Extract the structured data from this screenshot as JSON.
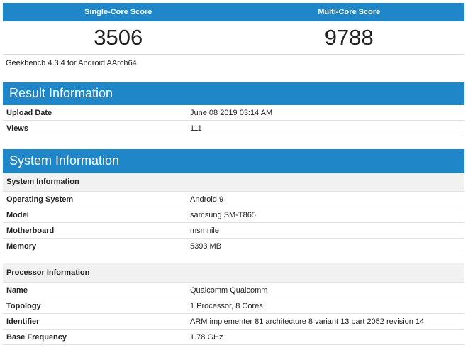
{
  "scores": {
    "single_label": "Single-Core Score",
    "multi_label": "Multi-Core Score",
    "single_value": "3506",
    "multi_value": "9788"
  },
  "version_text": "Geekbench 4.3.4 for Android AArch64",
  "result": {
    "title": "Result Information",
    "rows": [
      {
        "key": "Upload Date",
        "value": "June 08 2019 03:14 AM"
      },
      {
        "key": "Views",
        "value": "111"
      }
    ]
  },
  "system": {
    "title": "System Information",
    "sys_subhead": "System Information",
    "sys_rows": [
      {
        "key": "Operating System",
        "value": "Android 9"
      },
      {
        "key": "Model",
        "value": "samsung SM-T865"
      },
      {
        "key": "Motherboard",
        "value": "msmnile"
      },
      {
        "key": "Memory",
        "value": "5393 MB"
      }
    ],
    "proc_subhead": "Processor Information",
    "proc_rows": [
      {
        "key": "Name",
        "value": "Qualcomm Qualcomm"
      },
      {
        "key": "Topology",
        "value": "1 Processor, 8 Cores"
      },
      {
        "key": "Identifier",
        "value": "ARM implementer 81 architecture 8 variant 13 part 2052 revision 14"
      },
      {
        "key": "Base Frequency",
        "value": "1.78 GHz"
      }
    ]
  },
  "colors": {
    "header_blue": "#1f86c8",
    "subhead_gray": "#f1f1f1"
  }
}
